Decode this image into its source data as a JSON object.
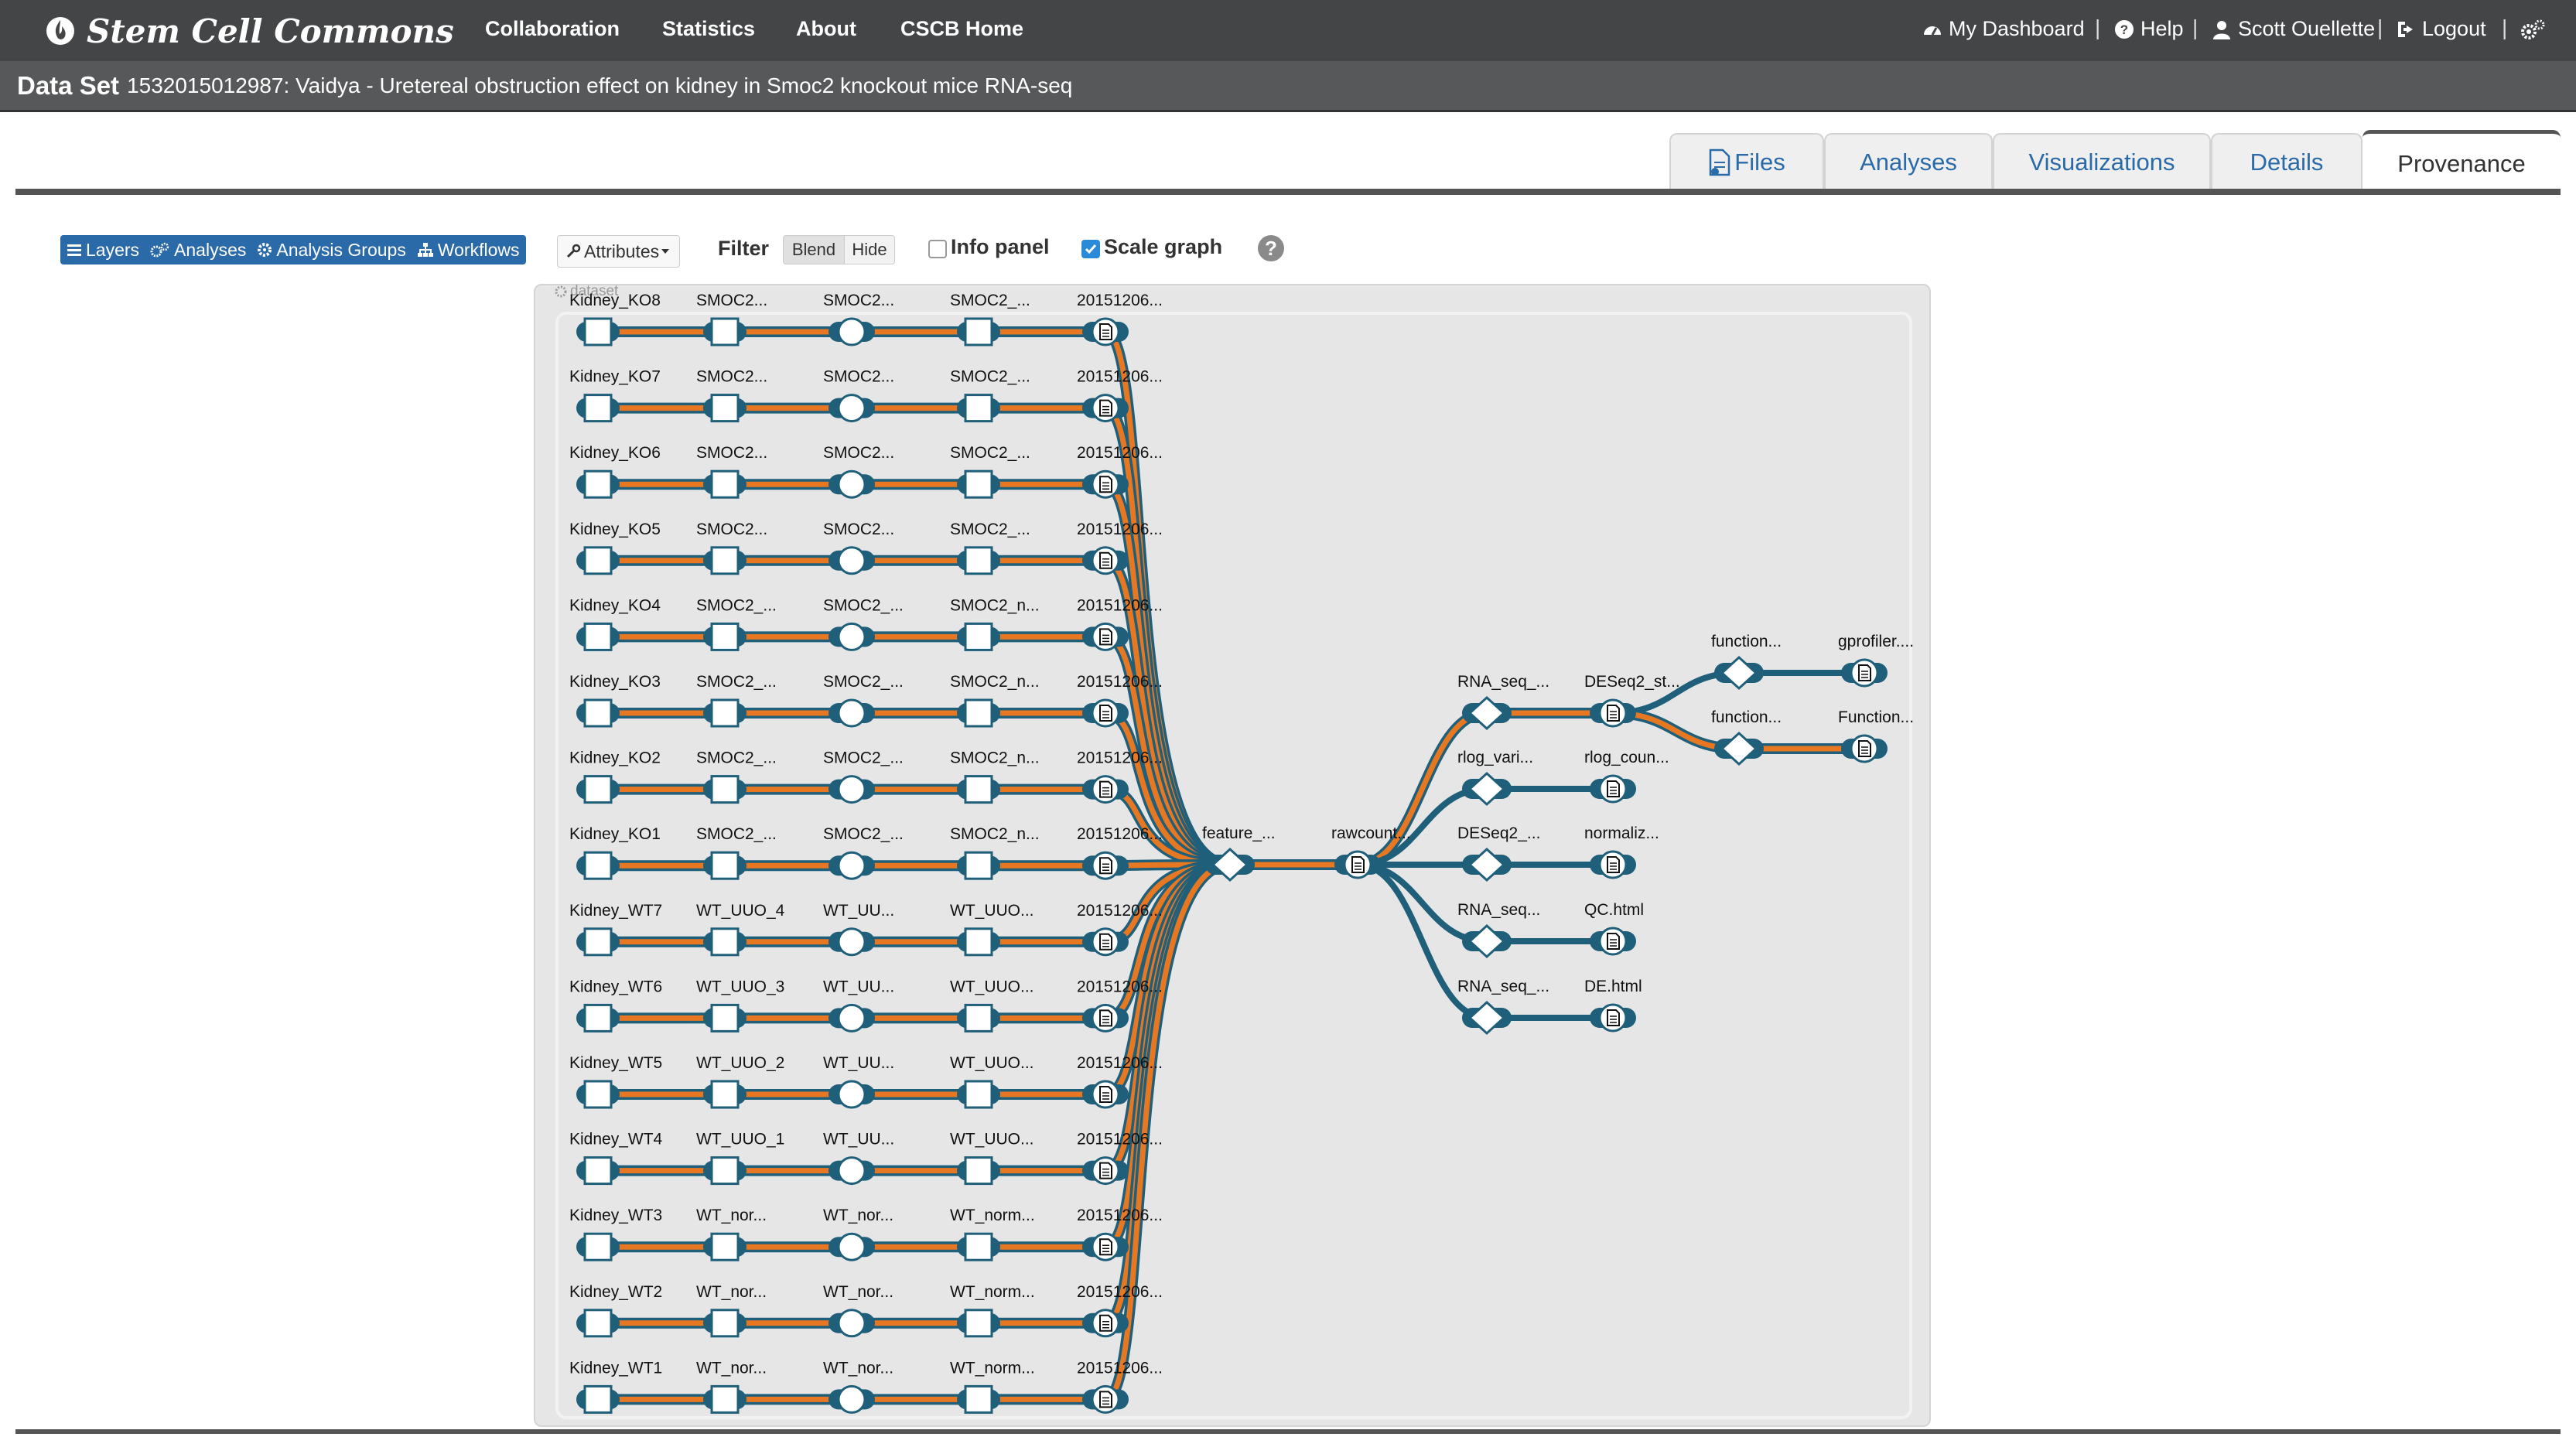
{
  "navbar": {
    "brand": "Stem Cell Commons",
    "links": [
      "Collaboration",
      "Statistics",
      "About",
      "CSCB Home"
    ],
    "dashboard": "My Dashboard",
    "help": "Help",
    "user": "Scott Ouellette",
    "logout": "Logout",
    "sep": "|"
  },
  "dataset": {
    "label": "Data Set",
    "title": "1532015012987: Vaidya - Uretereal obstruction effect on kidney in Smoc2 knockout mice RNA-seq"
  },
  "tabs": [
    "Files",
    "Analyses",
    "Visualizations",
    "Details",
    "Provenance"
  ],
  "active_tab": "Provenance",
  "toolbar": {
    "layer_buttons": [
      "Layers",
      "Analyses",
      "Analysis Groups",
      "Workflows"
    ],
    "attributes": "Attributes",
    "filter": "Filter",
    "blend": "Blend",
    "hide": "Hide",
    "info_panel": "Info panel",
    "info_panel_checked": false,
    "scale_graph": "Scale graph",
    "scale_graph_checked": true,
    "help": "?"
  },
  "graph": {
    "dataset_tag": "dataset",
    "rows": [
      [
        "Kidney_KO8",
        "SMOC2...",
        "SMOC2...",
        "SMOC2_...",
        "20151206..."
      ],
      [
        "Kidney_KO7",
        "SMOC2...",
        "SMOC2...",
        "SMOC2_...",
        "20151206..."
      ],
      [
        "Kidney_KO6",
        "SMOC2...",
        "SMOC2...",
        "SMOC2_...",
        "20151206..."
      ],
      [
        "Kidney_KO5",
        "SMOC2...",
        "SMOC2...",
        "SMOC2_...",
        "20151206..."
      ],
      [
        "Kidney_KO4",
        "SMOC2_...",
        "SMOC2_...",
        "SMOC2_n...",
        "20151206..."
      ],
      [
        "Kidney_KO3",
        "SMOC2_...",
        "SMOC2_...",
        "SMOC2_n...",
        "20151206..."
      ],
      [
        "Kidney_KO2",
        "SMOC2_...",
        "SMOC2_...",
        "SMOC2_n...",
        "20151206..."
      ],
      [
        "Kidney_KO1",
        "SMOC2_...",
        "SMOC2_...",
        "SMOC2_n...",
        "20151206..."
      ],
      [
        "Kidney_WT7",
        "WT_UUO_4",
        "WT_UU...",
        "WT_UUO...",
        "20151206..."
      ],
      [
        "Kidney_WT6",
        "WT_UUO_3",
        "WT_UU...",
        "WT_UUO...",
        "20151206..."
      ],
      [
        "Kidney_WT5",
        "WT_UUO_2",
        "WT_UU...",
        "WT_UUO...",
        "20151206..."
      ],
      [
        "Kidney_WT4",
        "WT_UUO_1",
        "WT_UU...",
        "WT_UUO...",
        "20151206..."
      ],
      [
        "Kidney_WT3",
        "WT_nor...",
        "WT_nor...",
        "WT_norm...",
        "20151206..."
      ],
      [
        "Kidney_WT2",
        "WT_nor...",
        "WT_nor...",
        "WT_norm...",
        "20151206..."
      ],
      [
        "Kidney_WT1",
        "WT_nor...",
        "WT_nor...",
        "WT_norm...",
        "20151206..."
      ]
    ],
    "feature": "feature_...",
    "rawcount": "rawcount...",
    "branches": [
      [
        "RNA_seq_...",
        "DESeq2_st..."
      ],
      [
        "rlog_vari...",
        "rlog_coun..."
      ],
      [
        "DESeq2_...",
        "normaliz..."
      ],
      [
        "RNA_seq...",
        "QC.html"
      ],
      [
        "RNA_seq_...",
        "DE.html"
      ]
    ],
    "functions": [
      [
        "function...",
        "gprofiler...."
      ],
      [
        "function...",
        "Function..."
      ]
    ],
    "colors": {
      "edge_orange": "#e87722",
      "edge_blue": "#1f5f7a",
      "node_blue": "#1f5f7a"
    }
  }
}
